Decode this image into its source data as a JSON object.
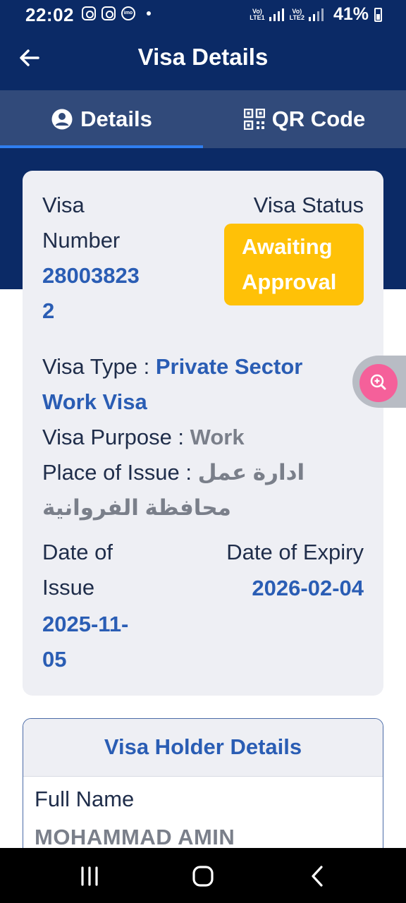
{
  "status_bar": {
    "time": "22:02",
    "sim1_label": "Vo)\nLTE1",
    "sim2_label": "Vo)\nLTE2",
    "battery": "41%",
    "icons": [
      "instagram-icon",
      "instagram-icon",
      "imo-icon",
      "notification-dot"
    ]
  },
  "app_bar": {
    "title": "Visa Details",
    "back_icon": "arrow-left-icon"
  },
  "tabs": [
    {
      "label": "Details",
      "icon": "user-circle-icon",
      "active": true
    },
    {
      "label": "QR Code",
      "icon": "qr-code-icon",
      "active": false
    }
  ],
  "visa_card": {
    "number_label_line1": "Visa",
    "number_label_line2": "Number",
    "number_value_line1": "28003823",
    "number_value_line2": "2",
    "status_label": "Visa Status",
    "status_line1": "Awaiting",
    "status_line2": "Approval",
    "type_label": "Visa Type : ",
    "type_value_line1": "Private Sector",
    "type_value_line2": "Work Visa",
    "purpose_label": "Visa Purpose : ",
    "purpose_value": "Work",
    "place_label": "Place of Issue : ",
    "place_value_line1": "ادارة عمل",
    "place_value_line2": "محافظة الفروانية",
    "issue_label_line1": "Date of",
    "issue_label_line2": "Issue",
    "issue_value_line1": "2025-11-",
    "issue_value_line2": "05",
    "expiry_label": "Date of Expiry",
    "expiry_value": "2026-02-04"
  },
  "holder_card": {
    "title": "Visa Holder Details",
    "full_name_label": "Full Name",
    "full_name_value": "MOHAMMAD AMIN"
  },
  "zoom_button": {
    "icon": "zoom-in-icon"
  },
  "nav_bar": {
    "icons": [
      "recent-apps-icon",
      "home-icon",
      "back-icon"
    ]
  },
  "colors": {
    "header": "#0b2a66",
    "tab_bar": "#314a7a",
    "tab_indicator": "#2f7ef0",
    "link_blue": "#2a5db4",
    "badge": "#ffc107",
    "card_bg": "#eeeff4",
    "zoom_pink": "#f5609a"
  }
}
